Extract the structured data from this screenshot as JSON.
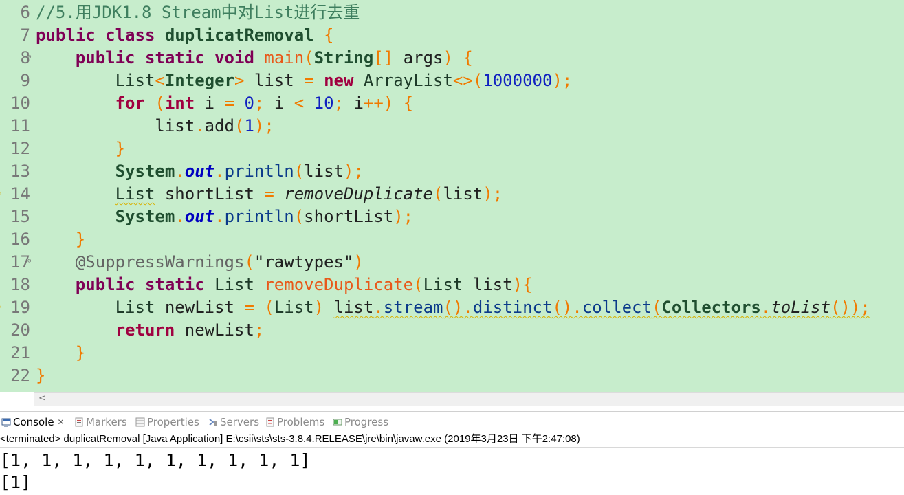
{
  "editor": {
    "line_numbers": [
      "6",
      "7",
      "8",
      "9",
      "10",
      "11",
      "12",
      "13",
      "14",
      "15",
      "16",
      "17",
      "18",
      "19",
      "20",
      "21",
      "22"
    ],
    "lines": {
      "l6": {
        "comment": "//5.用JDK1.8 Stream中对List进行去重"
      },
      "l7": {
        "kw1": "public",
        "kw2": "class",
        "name": "duplicatRemoval",
        "brace": "{"
      },
      "l8": {
        "kw1": "public",
        "kw2": "static",
        "kw3": "void",
        "name": "main",
        "p1": "(",
        "type": "String",
        "arr": "[]",
        "arg": "args",
        "p2": ")",
        "brace": "{"
      },
      "l9": {
        "t1": "List",
        "lt": "<",
        "t2": "Integer",
        "gt": ">",
        "var": "list",
        "eq": "=",
        "kw": "new",
        "t3": "ArrayList",
        "diamond": "<>",
        "p1": "(",
        "num": "1000000",
        "p2": ");"
      },
      "l10": {
        "kw": "for",
        "p1": "(",
        "kw2": "int",
        "v1": "i",
        "eq": "=",
        "n1": "0",
        "s1": ";",
        "v2": "i",
        "lt": "<",
        "n2": "10",
        "s2": ";",
        "v3": "i",
        "pp": "++",
        "p2": ")",
        "brace": "{"
      },
      "l11": {
        "obj": "list",
        "dot": ".",
        "m": "add",
        "p1": "(",
        "n": "1",
        "p2": ");"
      },
      "l12": {
        "brace": "}"
      },
      "l13": {
        "cls": "System",
        "dot1": ".",
        "field": "out",
        "dot2": ".",
        "m": "println",
        "p1": "(",
        "arg": "list",
        "p2": ");"
      },
      "l14": {
        "t": "List",
        "var": "shortList",
        "eq": "=",
        "m": "removeDuplicate",
        "p1": "(",
        "arg": "list",
        "p2": ");"
      },
      "l15": {
        "cls": "System",
        "dot1": ".",
        "field": "out",
        "dot2": ".",
        "m": "println",
        "p1": "(",
        "arg": "shortList",
        "p2": ");"
      },
      "l16": {
        "brace": "}"
      },
      "l17": {
        "ann": "@SuppressWarnings",
        "p1": "(",
        "str": "\"rawtypes\"",
        "p2": ")"
      },
      "l18": {
        "kw1": "public",
        "kw2": "static",
        "t": "List",
        "name": "removeDuplicate",
        "p1": "(",
        "t2": "List",
        "arg": "list",
        "p2": ")",
        "brace": "{"
      },
      "l19": {
        "t": "List",
        "var": "newList",
        "eq": "=",
        "p1": "(",
        "cast": "List",
        "p2": ")",
        "obj": "list",
        "d1": ".",
        "m1": "stream",
        "c1": "()",
        "d2": ".",
        "m2": "distinct",
        "c2": "()",
        "d3": ".",
        "m3": "collect",
        "p3": "(",
        "cls": "Collectors",
        "d4": ".",
        "m4": "toList",
        "end": "());"
      },
      "l20": {
        "kw": "return",
        "var": "newList",
        "semi": ";"
      },
      "l21": {
        "brace": "}"
      },
      "l22": {
        "brace": "}"
      }
    }
  },
  "console": {
    "tabs": [
      {
        "label": "Console",
        "icon": "console-icon",
        "active": true,
        "close": "✕"
      },
      {
        "label": "Markers",
        "icon": "markers-icon"
      },
      {
        "label": "Properties",
        "icon": "properties-icon"
      },
      {
        "label": "Servers",
        "icon": "servers-icon"
      },
      {
        "label": "Problems",
        "icon": "problems-icon"
      },
      {
        "label": "Progress",
        "icon": "progress-icon"
      }
    ],
    "header": "<terminated> duplicatRemoval [Java Application] E:\\csii\\sts\\sts-3.8.4.RELEASE\\jre\\bin\\javaw.exe (2019年3月23日 下午2:47:08)",
    "output": [
      "[1, 1, 1, 1, 1, 1, 1, 1, 1, 1]",
      "[1]"
    ]
  },
  "colors": {
    "editor_bg": "#c7edcc",
    "keyword": "#7f0055",
    "comment": "#3f7f5f",
    "number": "#1020c0",
    "punctuation": "#f07a00"
  }
}
